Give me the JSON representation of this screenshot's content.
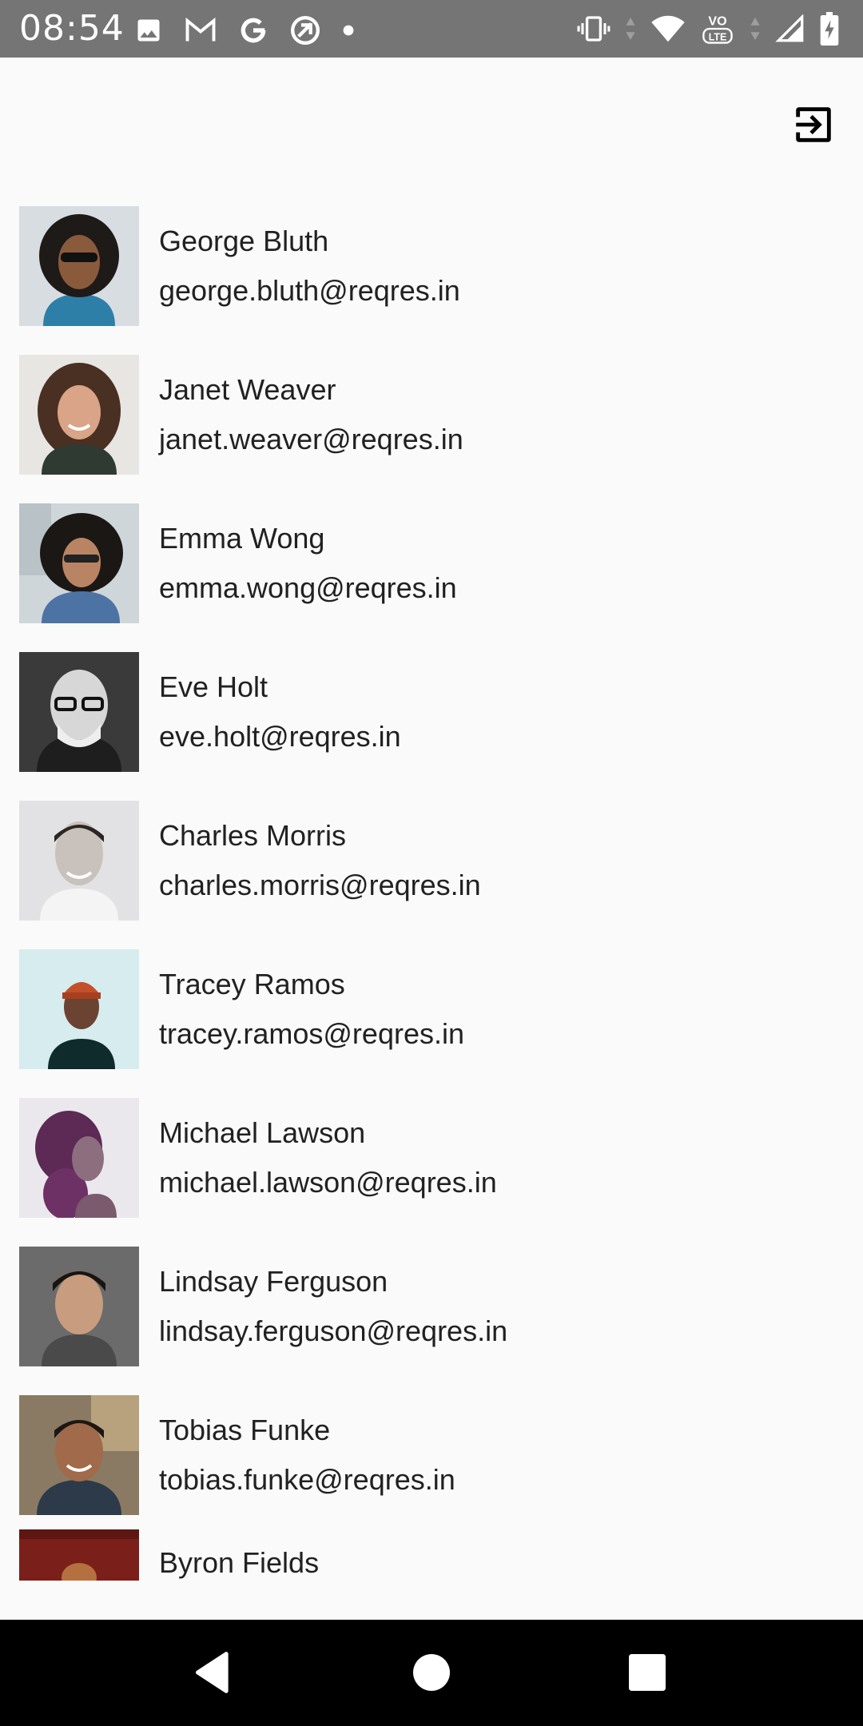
{
  "status_bar": {
    "time": "08:54",
    "left_icons": [
      "image-icon",
      "gmail-icon",
      "google-icon",
      "sync-icon",
      "dot-icon"
    ],
    "right_icons": [
      "vibrate-icon",
      "wifi-icon",
      "volte-icon",
      "signal-icon",
      "battery-charging-icon"
    ],
    "volte_label": "VO",
    "lte_label": "LTE"
  },
  "app_bar": {
    "logout_icon": "logout-icon"
  },
  "users": [
    {
      "name": "George Bluth",
      "email": "george.bluth@reqres.in"
    },
    {
      "name": "Janet Weaver",
      "email": "janet.weaver@reqres.in"
    },
    {
      "name": "Emma Wong",
      "email": "emma.wong@reqres.in"
    },
    {
      "name": "Eve Holt",
      "email": "eve.holt@reqres.in"
    },
    {
      "name": "Charles Morris",
      "email": "charles.morris@reqres.in"
    },
    {
      "name": "Tracey Ramos",
      "email": "tracey.ramos@reqres.in"
    },
    {
      "name": "Michael Lawson",
      "email": "michael.lawson@reqres.in"
    },
    {
      "name": "Lindsay Ferguson",
      "email": "lindsay.ferguson@reqres.in"
    },
    {
      "name": "Tobias Funke",
      "email": "tobias.funke@reqres.in"
    },
    {
      "name": "Byron Fields",
      "email": ""
    }
  ],
  "nav_bar": {
    "buttons": [
      "back-icon",
      "home-icon",
      "recents-icon"
    ]
  },
  "colors": {
    "status_bar_bg": "#757575",
    "background": "#fafafa",
    "text": "#212121",
    "nav_bar_bg": "#000000"
  }
}
